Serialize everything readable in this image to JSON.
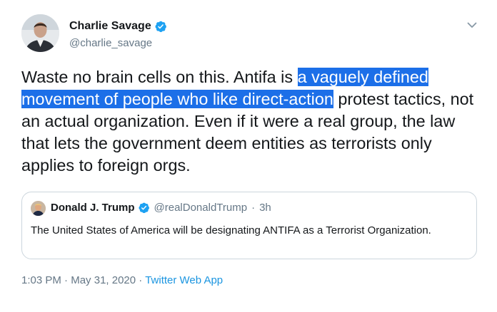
{
  "author": {
    "name": "Charlie Savage",
    "handle": "@charlie_savage",
    "verified": true
  },
  "tweet": {
    "text_before": "Waste no brain cells on this. Antifa is",
    "text_highlight_line1": "a vaguely defined",
    "text_highlight_line2": "movement of people who like direct-action",
    "text_after": "protest tactics, not an actual organization. Even if it were a real group, the law that lets the government deem entities as terrorists only applies to foreign orgs."
  },
  "quoted": {
    "name": "Donald J. Trump",
    "handle": "@realDonaldTrump",
    "separator": "·",
    "time": "3h",
    "text": "The United States of America will be designating ANTIFA as a Terrorist Organization."
  },
  "meta": {
    "time": "1:03 PM",
    "separator1": "·",
    "date": "May 31, 2020",
    "separator2": "·",
    "source": "Twitter Web App"
  },
  "icons": {
    "verified": "verified-badge-icon",
    "menu": "chevron-down-icon"
  },
  "colors": {
    "highlight": "#1c6fe8",
    "verified": "#1da1f2",
    "link": "#1b95e0",
    "secondary_text": "#657786"
  }
}
